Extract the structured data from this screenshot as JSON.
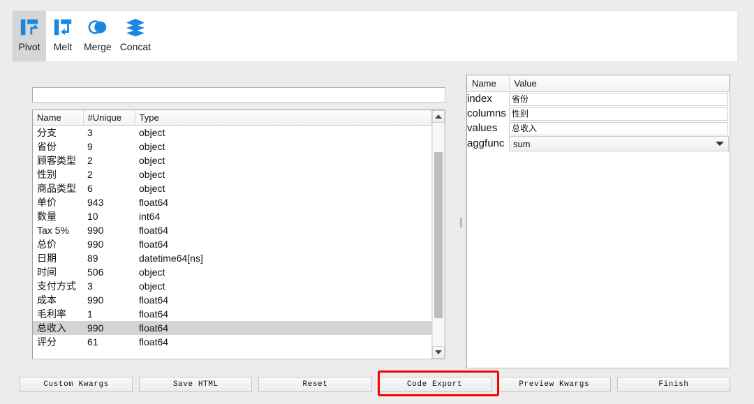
{
  "ribbon": {
    "tabs": [
      {
        "label": "Pivot",
        "icon": "pivot-icon",
        "active": true
      },
      {
        "label": "Melt",
        "icon": "melt-icon",
        "active": false
      },
      {
        "label": "Merge",
        "icon": "merge-icon",
        "active": false
      },
      {
        "label": "Concat",
        "icon": "concat-icon",
        "active": false
      }
    ],
    "accent_color": "#1a88e0"
  },
  "left_panel": {
    "filter": {
      "value": "",
      "placeholder": ""
    },
    "columns": [
      "Name",
      "#Unique",
      "Type"
    ],
    "rows": [
      {
        "name": "分支",
        "unique": "3",
        "type": "object",
        "selected": false
      },
      {
        "name": "省份",
        "unique": "9",
        "type": "object",
        "selected": false
      },
      {
        "name": "顾客类型",
        "unique": "2",
        "type": "object",
        "selected": false
      },
      {
        "name": "性别",
        "unique": "2",
        "type": "object",
        "selected": false
      },
      {
        "name": "商品类型",
        "unique": "6",
        "type": "object",
        "selected": false
      },
      {
        "name": "单价",
        "unique": "943",
        "type": "float64",
        "selected": false
      },
      {
        "name": "数量",
        "unique": "10",
        "type": "int64",
        "selected": false
      },
      {
        "name": "Tax 5%",
        "unique": "990",
        "type": "float64",
        "selected": false
      },
      {
        "name": "总价",
        "unique": "990",
        "type": "float64",
        "selected": false
      },
      {
        "name": "日期",
        "unique": "89",
        "type": "datetime64[ns]",
        "selected": false
      },
      {
        "name": "时间",
        "unique": "506",
        "type": "object",
        "selected": false
      },
      {
        "name": "支付方式",
        "unique": "3",
        "type": "object",
        "selected": false
      },
      {
        "name": "成本",
        "unique": "990",
        "type": "float64",
        "selected": false
      },
      {
        "name": "毛利率",
        "unique": "1",
        "type": "float64",
        "selected": false
      },
      {
        "name": "总收入",
        "unique": "990",
        "type": "float64",
        "selected": true
      },
      {
        "name": "评分",
        "unique": "61",
        "type": "float64",
        "selected": false
      }
    ]
  },
  "right_panel": {
    "columns": [
      "Name",
      "Value"
    ],
    "rows": [
      {
        "name": "index",
        "value": "省份",
        "kind": "text"
      },
      {
        "name": "columns",
        "value": "性别",
        "kind": "text"
      },
      {
        "name": "values",
        "value": "总收入",
        "kind": "text"
      },
      {
        "name": "aggfunc",
        "value": "sum",
        "kind": "combo"
      }
    ]
  },
  "buttons": [
    {
      "label": "Custom Kwargs",
      "highlighted": false
    },
    {
      "label": "Save HTML",
      "highlighted": false
    },
    {
      "label": "Reset",
      "highlighted": false
    },
    {
      "label": "Code Export",
      "highlighted": true
    },
    {
      "label": "Preview Kwargs",
      "highlighted": false
    },
    {
      "label": "Finish",
      "highlighted": false
    }
  ],
  "highlight": {
    "color": "#fb0000"
  }
}
